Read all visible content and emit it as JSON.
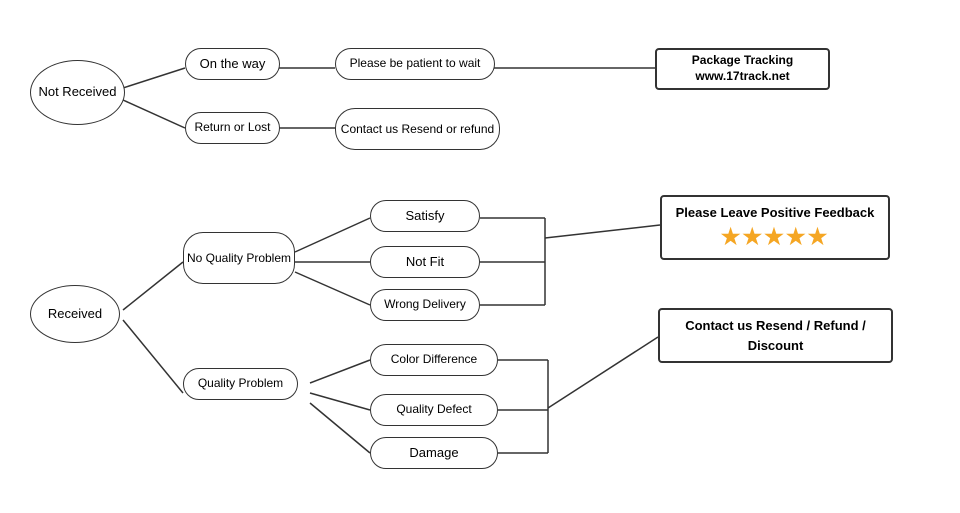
{
  "nodes": {
    "not_received": {
      "label": "Not\nReceived"
    },
    "received": {
      "label": "Received"
    },
    "on_the_way": {
      "label": "On the way"
    },
    "return_or_lost": {
      "label": "Return or Lost"
    },
    "patient": {
      "label": "Please be patient to wait"
    },
    "contact_us_1": {
      "label": "Contact us\nResend or refund"
    },
    "package_tracking": {
      "label": "Package Tracking\nwww.17track.net"
    },
    "no_quality": {
      "label": "No\nQuality Problem"
    },
    "quality_problem": {
      "label": "Quality Problem"
    },
    "satisfy": {
      "label": "Satisfy"
    },
    "not_fit": {
      "label": "Not Fit"
    },
    "wrong_delivery": {
      "label": "Wrong Delivery"
    },
    "color_diff": {
      "label": "Color Difference"
    },
    "quality_defect": {
      "label": "Quality Defect"
    },
    "damage": {
      "label": "Damage"
    },
    "feedback": {
      "label": "Please Leave Positive Feedback",
      "stars": "★★★★★"
    },
    "contact_us_2": {
      "label": "Contact us\nResend / Refund / Discount"
    }
  }
}
